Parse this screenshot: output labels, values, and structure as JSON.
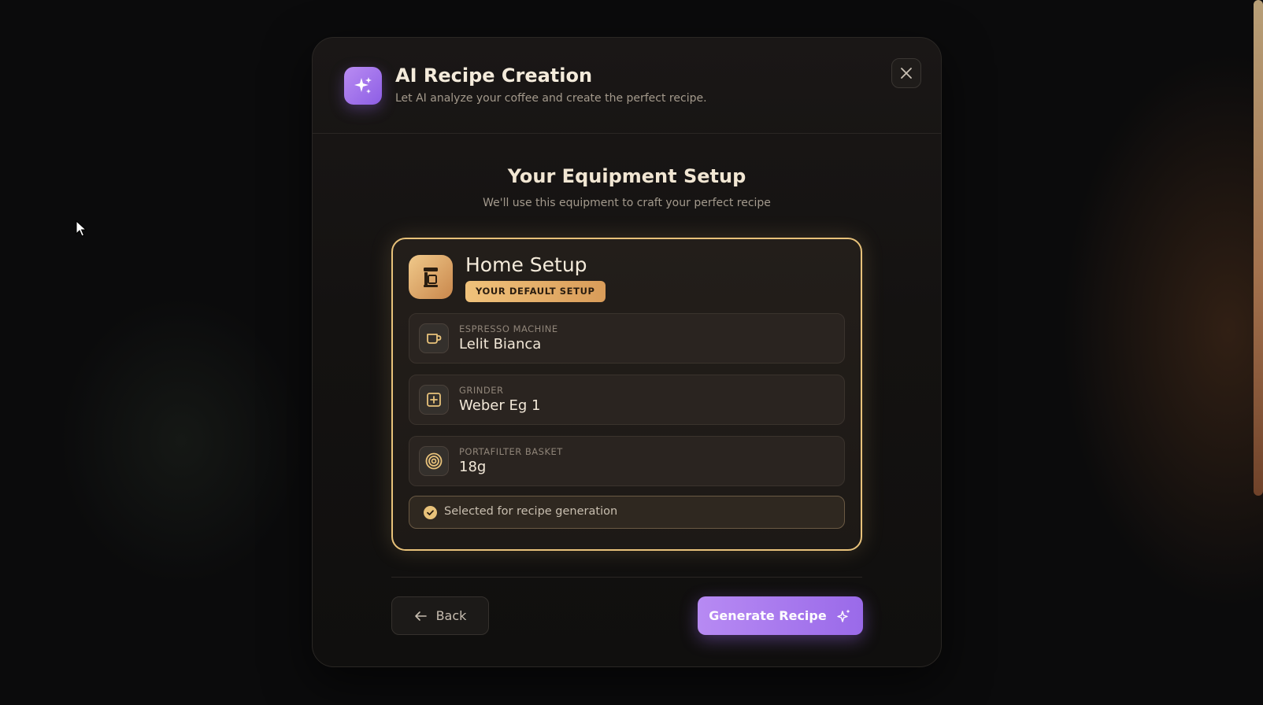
{
  "modal": {
    "title": "AI Recipe Creation",
    "subtitle": "Let AI analyze your coffee and create the perfect recipe.",
    "close_icon": "close-icon",
    "header_icon": "sparkles-icon"
  },
  "section": {
    "title": "Your Equipment Setup",
    "subtitle": "We'll use this equipment to craft your perfect recipe"
  },
  "setup": {
    "name": "Home Setup",
    "badge": "YOUR DEFAULT SETUP",
    "icon": "coffee-machine-icon",
    "items": [
      {
        "label": "ESPRESSO MACHINE",
        "value": "Lelit Bianca",
        "icon": "cup-icon"
      },
      {
        "label": "GRINDER",
        "value": "Weber Eg 1",
        "icon": "grinder-icon"
      },
      {
        "label": "PORTAFILTER BASKET",
        "value": "18g",
        "icon": "target-icon"
      }
    ],
    "selected_text": "Selected for recipe generation"
  },
  "actions": {
    "back_label": "Back",
    "generate_label": "Generate Recipe"
  },
  "colors": {
    "accent_gold": "#e8c27a",
    "accent_purple": "#9a6ae9",
    "background": "#0b0b0c"
  }
}
